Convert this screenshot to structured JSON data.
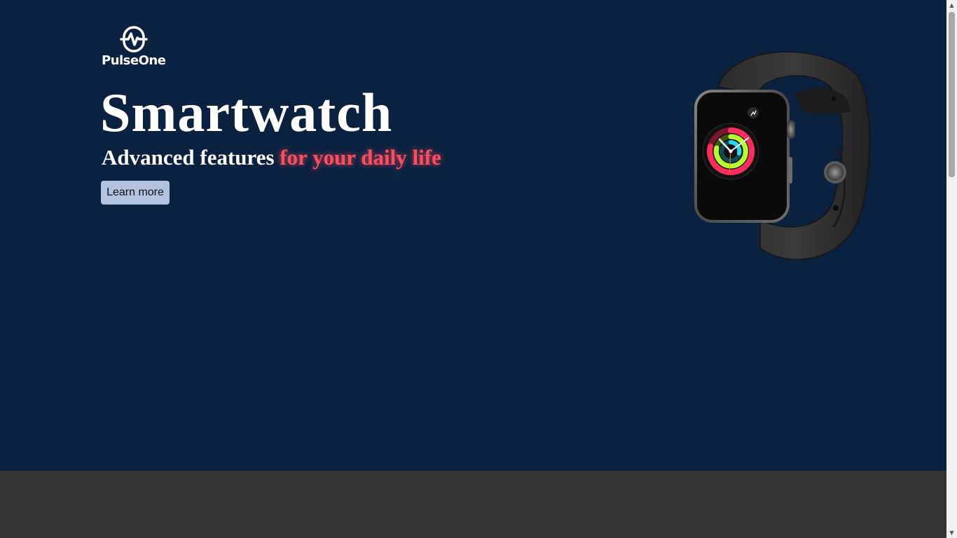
{
  "brand": {
    "name": "PulseOne",
    "logo_icon": "pulse-circle-icon"
  },
  "hero": {
    "title": "Smartwatch",
    "subtitle_main": "Advanced features ",
    "subtitle_accent": "for your daily life",
    "cta_label": "Learn more",
    "image": "smartwatch-image"
  },
  "colors": {
    "hero_background": "#0a2240",
    "footer_background": "#333333",
    "accent": "#ff4d5e",
    "button_background": "#b2c3df"
  }
}
